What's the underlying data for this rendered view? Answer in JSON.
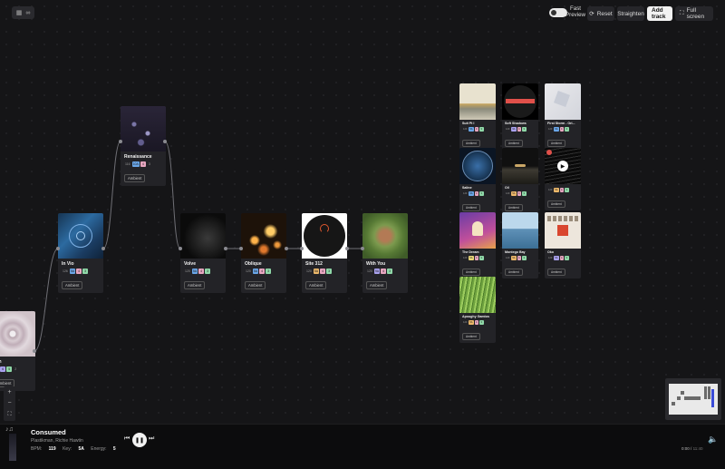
{
  "toolbar": {
    "fast_preview_line1": "Fast",
    "fast_preview_line2": "Preview",
    "reset_label": "Reset",
    "straighten_label": "Straighten",
    "add_track_label": "Add track",
    "fullscreen_label": "Full screen"
  },
  "chain": [
    {
      "title": "ach",
      "tags": [
        "2A",
        "6",
        "5",
        "2"
      ],
      "genre": "Ambient"
    },
    {
      "title": "In Vio",
      "tags": [
        "126",
        "5A",
        "4",
        "3"
      ],
      "genre": "Ambient"
    },
    {
      "title": "Renaissance",
      "tags": [
        "116",
        "10A",
        "4",
        "3"
      ],
      "genre": "Ambient"
    },
    {
      "title": "Volve",
      "tags": [
        "120",
        "5A",
        "4",
        "3"
      ],
      "genre": "Ambient"
    },
    {
      "title": "Oblique",
      "tags": [
        "120",
        "5A",
        "4",
        "3"
      ],
      "genre": "Ambient"
    },
    {
      "title": "Site 312",
      "tags": [
        "120",
        "5A",
        "4",
        "3"
      ],
      "genre": "Ambient"
    },
    {
      "title": "With You",
      "tags": [
        "120",
        "9A",
        "4",
        "3"
      ],
      "genre": "Ambient"
    }
  ],
  "library": [
    {
      "title": "Suit Pt I",
      "tags": [
        "120",
        "5A",
        "4",
        "3"
      ],
      "genre": "Ambient"
    },
    {
      "title": "Soft Shadows",
      "tags": [
        "120",
        "9A",
        "4",
        "3"
      ],
      "genre": "Ambient"
    },
    {
      "title": "First Storm - Ori...",
      "tags": [
        "120",
        "5A",
        "4",
        "3"
      ],
      "genre": "Ambient"
    },
    {
      "title": "Saline",
      "tags": [
        "120",
        "5A",
        "4",
        "3"
      ],
      "genre": "Ambient"
    },
    {
      "title": "Oil",
      "tags": [
        "120",
        "5A",
        "4",
        "3"
      ],
      "genre": "Ambient"
    },
    {
      "title": "",
      "tags": [
        "120",
        "5A",
        "4",
        "3"
      ],
      "genre": "Ambient"
    },
    {
      "title": "The Dream",
      "tags": [
        "120",
        "5A",
        "4",
        "3"
      ],
      "genre": "Ambient"
    },
    {
      "title": "Montego Bay",
      "tags": [
        "120",
        "5A",
        "4",
        "3"
      ],
      "genre": "Ambient"
    },
    {
      "title": "Oko",
      "tags": [
        "120",
        "5A",
        "4",
        "3"
      ],
      "genre": "Ambient"
    },
    {
      "title": "Apoughy Gamtos",
      "tags": [
        "120",
        "5A",
        "4",
        "3"
      ],
      "genre": "Ambient"
    }
  ],
  "zoom": {
    "plus": "+",
    "minus": "−"
  },
  "player": {
    "title": "Consumed",
    "artists": "Plastikman, Richie Hawtin",
    "bpm_label": "BPM:",
    "bpm": "119",
    "key_label": "Key:",
    "key": "5A",
    "energy_label": "Energy:",
    "energy": "5",
    "time_current": "0:00",
    "time_sep": "/",
    "time_total": "11:40"
  },
  "colors": {
    "accent": "#f2f2f2",
    "background": "#151517",
    "card": "#232327",
    "link": "#8a8a90"
  }
}
